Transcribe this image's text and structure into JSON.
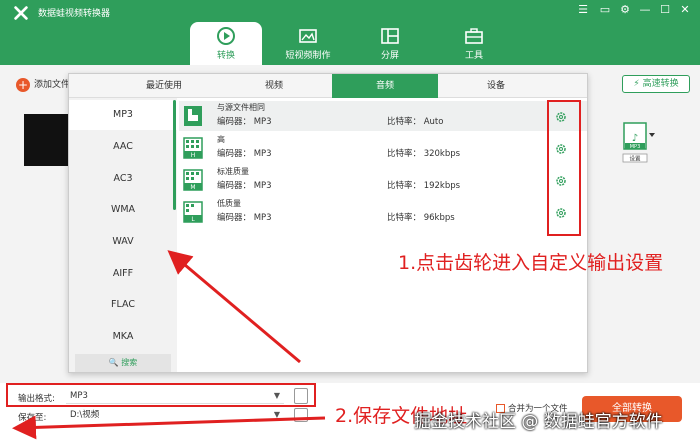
{
  "app": {
    "title": "数据蛙视频转换器"
  },
  "window_controls": {
    "menu": "☰",
    "feedback": "▭",
    "settings": "⚙",
    "minimize": "—",
    "maximize": "☐",
    "close": "✕"
  },
  "nav_tabs": [
    {
      "label": "转换",
      "icon": "convert-icon",
      "active": true
    },
    {
      "label": "短视频制作",
      "icon": "short-video-icon",
      "active": false
    },
    {
      "label": "分屏",
      "icon": "split-screen-icon",
      "active": false
    },
    {
      "label": "工具",
      "icon": "toolbox-icon",
      "active": false
    }
  ],
  "toolbar": {
    "add_file": "添加文件",
    "fast_convert": "高速转换",
    "format_badge": "MP3",
    "settings_label": "设置"
  },
  "popup": {
    "tabs": [
      {
        "label": "最近使用",
        "active": false
      },
      {
        "label": "视频",
        "active": false
      },
      {
        "label": "音频",
        "active": true
      },
      {
        "label": "设备",
        "active": false
      }
    ],
    "formats": [
      "MP3",
      "AAC",
      "AC3",
      "WMA",
      "WAV",
      "AIFF",
      "FLAC",
      "MKA"
    ],
    "active_format": "MP3",
    "search_label": "搜索",
    "presets": [
      {
        "name": "与源文件相同",
        "codec": "编码器：  MP3",
        "bitrate": "比特率：  Auto",
        "icon": "same-as-source-icon",
        "badge": ""
      },
      {
        "name": "高",
        "codec": "编码器：  MP3",
        "bitrate": "比特率：  320kbps",
        "icon": "high-quality-icon",
        "badge": "H"
      },
      {
        "name": "标准质量",
        "codec": "编码器：  MP3",
        "bitrate": "比特率：  192kbps",
        "icon": "medium-quality-icon",
        "badge": "M"
      },
      {
        "name": "低质量",
        "codec": "编码器：  MP3",
        "bitrate": "比特率：  96kbps",
        "icon": "low-quality-icon",
        "badge": "L"
      }
    ]
  },
  "bottom": {
    "output_format_label": "输出格式:",
    "output_format_value": "MP3",
    "save_to_label": "保存至:",
    "save_to_value": "D:\\视频",
    "merge_label": "合并为一个文件",
    "convert_all": "全部转换"
  },
  "annotations": {
    "step1": "1.点击齿轮进入自定义输出设置",
    "step2": "2.保存文件地址"
  },
  "watermark": "掘金技术社区 @ 数据蛙官方软件",
  "colors": {
    "brand": "#2f9e5b",
    "accent": "#e8582a",
    "annotation": "#e02020"
  }
}
